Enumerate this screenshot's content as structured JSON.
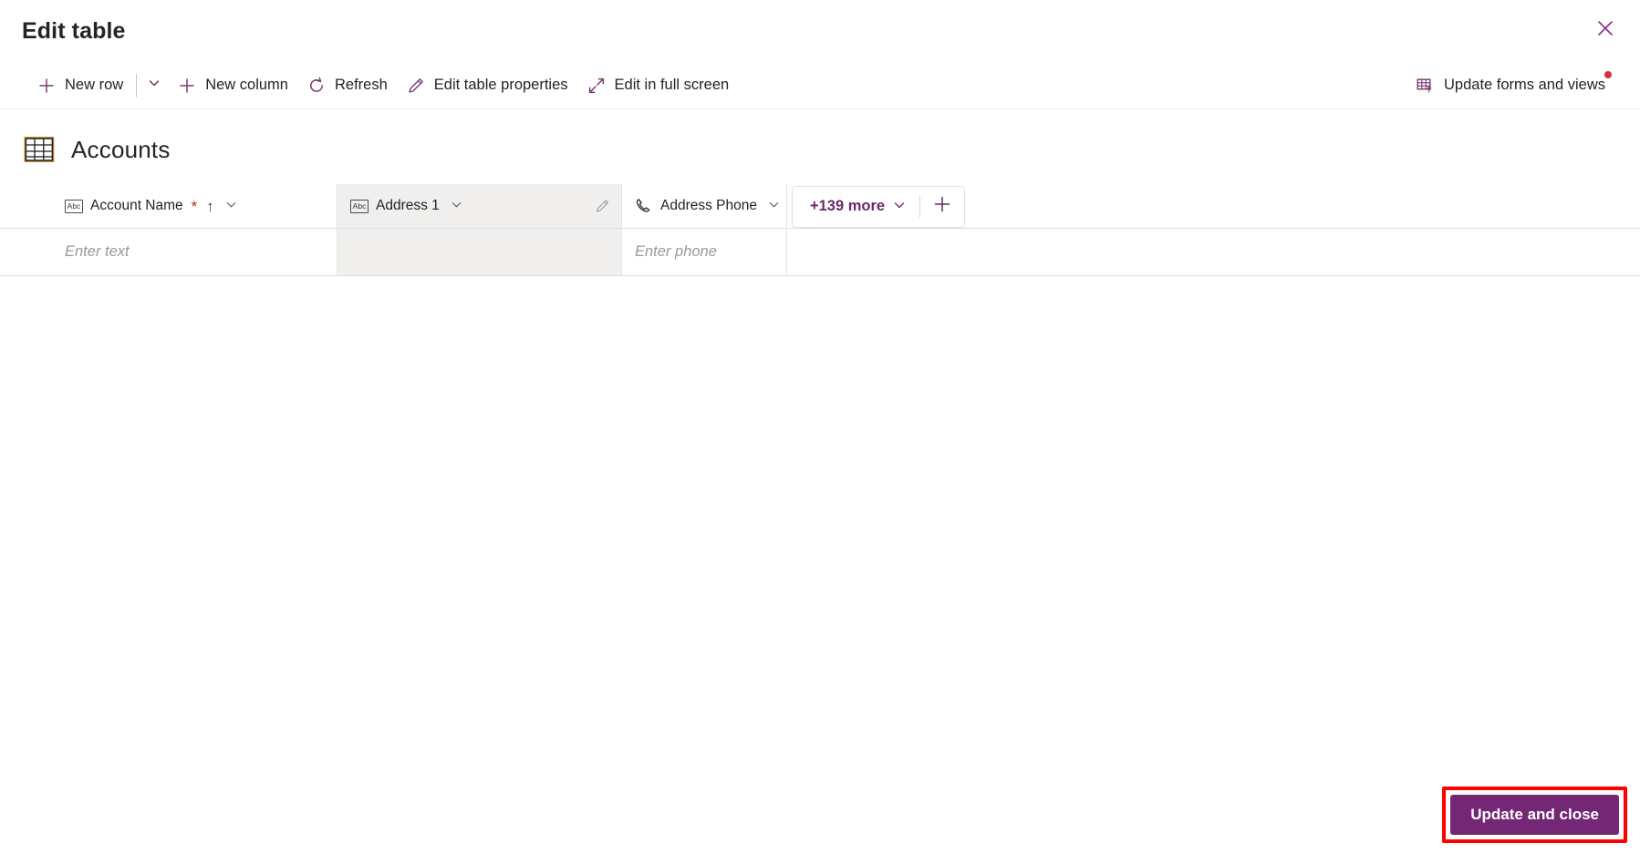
{
  "dialog": {
    "title": "Edit table",
    "close_icon": "close-icon"
  },
  "toolbar": {
    "items": [
      {
        "id": "new-row",
        "label": "New row",
        "icon": "plus-icon",
        "has_caret": true
      },
      {
        "id": "new-column",
        "label": "New column",
        "icon": "plus-icon",
        "has_caret": false
      },
      {
        "id": "refresh",
        "label": "Refresh",
        "icon": "refresh-icon",
        "has_caret": false
      },
      {
        "id": "edit-table-properties",
        "label": "Edit table properties",
        "icon": "pencil-icon",
        "has_caret": false
      },
      {
        "id": "edit-in-full-screen",
        "label": "Edit in full screen",
        "icon": "expand-arrows-icon",
        "has_caret": false
      }
    ],
    "update_forms_and_views": {
      "label": "Update forms and views",
      "icon": "table-lightning-icon",
      "badge": true,
      "badge_color": "#d13438"
    }
  },
  "entity": {
    "name": "Accounts",
    "icon": "table-icon"
  },
  "grid": {
    "columns": [
      {
        "id": "account-name",
        "label": "Account Name",
        "type_icon": "abc-icon",
        "type_icon_text": "Abc",
        "required": true,
        "required_marker": "*",
        "sorted": true,
        "sort_direction": "ascending",
        "sort_glyph": "↑",
        "chevron": "∨",
        "selected": false,
        "placeholder": "Enter text"
      },
      {
        "id": "address-1",
        "label": "Address 1",
        "type_icon": "abc-icon",
        "type_icon_text": "Abc",
        "required": false,
        "required_marker": "",
        "sorted": false,
        "sort_direction": "",
        "sort_glyph": "",
        "chevron": "∨",
        "selected": true,
        "placeholder": "",
        "edit_icon": "pencil-icon"
      },
      {
        "id": "address-phone",
        "label": "Address Phone",
        "type_icon": "phone-icon",
        "type_icon_text": "",
        "required": false,
        "required_marker": "",
        "sorted": false,
        "sort_direction": "",
        "sort_glyph": "",
        "chevron": "∨",
        "selected": false,
        "placeholder": "Enter phone"
      }
    ],
    "more_columns": {
      "label": "+139 more",
      "count": 139,
      "chevron": "∨",
      "add_label": "",
      "add_icon": "plus-icon"
    },
    "rows": [
      {
        "account_name": "",
        "address_1": "",
        "address_phone": ""
      }
    ]
  },
  "footer": {
    "primary_button": {
      "label": "Update and close",
      "background": "#742774",
      "text_color": "#ffffff"
    },
    "highlight": {
      "color": "#ff0000",
      "target": "update-and-close-button"
    }
  },
  "theme": {
    "accent": "#742774",
    "icon_purple": "#7a3b76",
    "required_red": "#b3261e",
    "text": "#242424",
    "selected_cell_bg": "#f0efee"
  }
}
